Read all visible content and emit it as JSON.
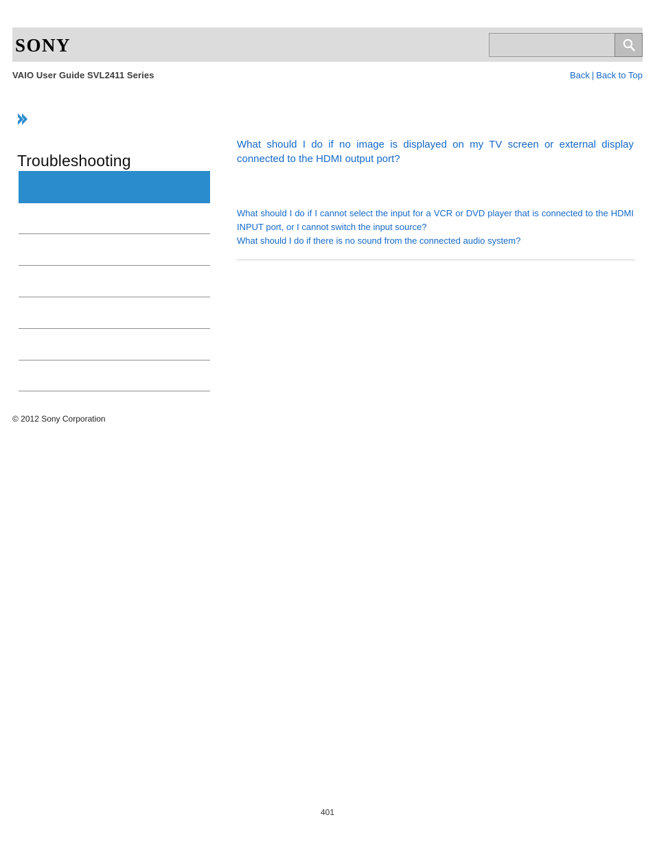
{
  "header": {
    "logo_text": "SONY",
    "search": {
      "value": "",
      "placeholder": "",
      "icon": "search-icon",
      "button_label": ""
    },
    "guide_title": "VAIO User Guide SVL2411 Series",
    "nav": {
      "back": "Back",
      "separator": "|",
      "back_to_top": "Back to Top"
    }
  },
  "sidebar": {
    "arrow_icon": "double-chevron-right-icon",
    "section_heading": "Troubleshooting",
    "highlight_color": "#2b8ccd",
    "nav_items": [
      {
        "label": ""
      },
      {
        "label": ""
      },
      {
        "label": ""
      },
      {
        "label": ""
      },
      {
        "label": ""
      },
      {
        "label": ""
      },
      {
        "label": ""
      }
    ],
    "copyright": "© 2012 Sony Corporation"
  },
  "content": {
    "topic_title": "What should I do if no image is displayed on my TV screen or external display connected to the HDMI output port?",
    "related_links": [
      "What should I do if I cannot select the input for a VCR or DVD player that is connected to the HDMI INPUT port, or I cannot switch the input source?",
      "What should I do if there is no sound from the connected audio system?"
    ]
  },
  "footer": {
    "page_number": "401"
  },
  "colors": {
    "link_blue": "#1569c7",
    "accent_blue": "#2b8ccd",
    "header_gray": "#dcdcdc",
    "divider_gray": "#8f8f8f"
  }
}
